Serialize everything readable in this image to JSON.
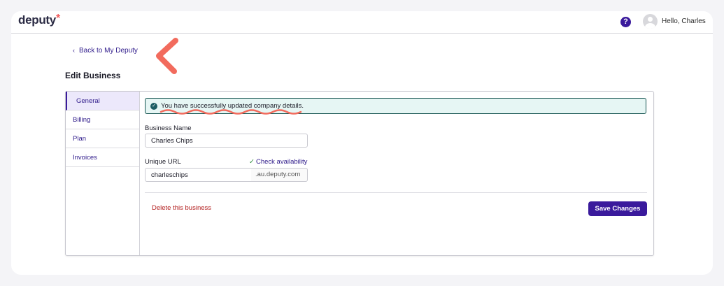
{
  "app": {
    "logo_text": "deputy",
    "logo_mark": "*",
    "brand_color": "#3a1a9c",
    "accent_color": "#f15b5b"
  },
  "header": {
    "help_label": "?",
    "user_greeting": "Hello, Charles"
  },
  "nav": {
    "back_label": "Back to My Deputy"
  },
  "page": {
    "title": "Edit Business"
  },
  "sidebar": {
    "items": [
      {
        "label": "General",
        "active": true
      },
      {
        "label": "Billing",
        "active": false
      },
      {
        "label": "Plan",
        "active": false
      },
      {
        "label": "Invoices",
        "active": false
      }
    ]
  },
  "alert": {
    "message": "You have successfully updated company details."
  },
  "form": {
    "business_name_label": "Business Name",
    "business_name_value": "Charles Chips",
    "unique_url_label": "Unique URL",
    "check_availability_label": "Check availability",
    "unique_url_value": "charleschips",
    "url_suffix": ".au.deputy.com",
    "delete_label": "Delete this business",
    "save_label": "Save Changes"
  }
}
